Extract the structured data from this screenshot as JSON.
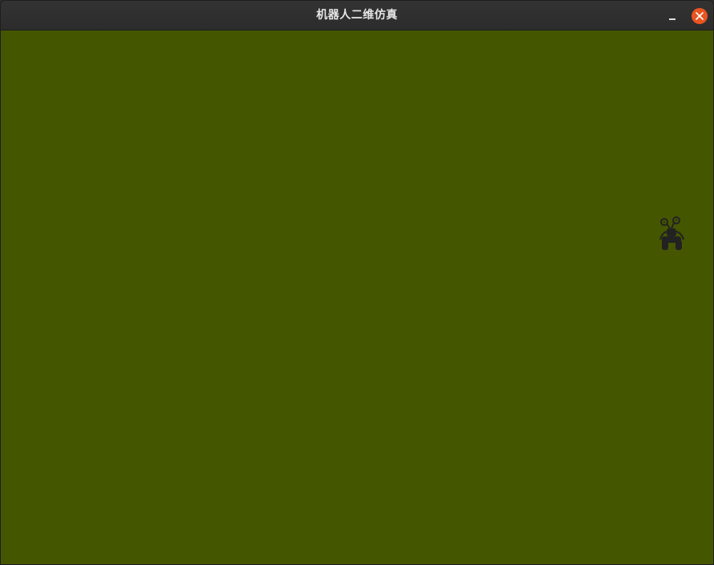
{
  "window": {
    "title": "机器人二维仿真"
  },
  "controls": {
    "minimize_icon": "minimize-icon",
    "close_icon": "close-icon"
  },
  "colors": {
    "titlebar": "#2c2c2c",
    "title_text": "#e6e6e6",
    "close_button": "#e95420",
    "canvas_background": "#455600",
    "robot": "#222222"
  },
  "canvas": {
    "robot_icon": "robot-icon"
  }
}
